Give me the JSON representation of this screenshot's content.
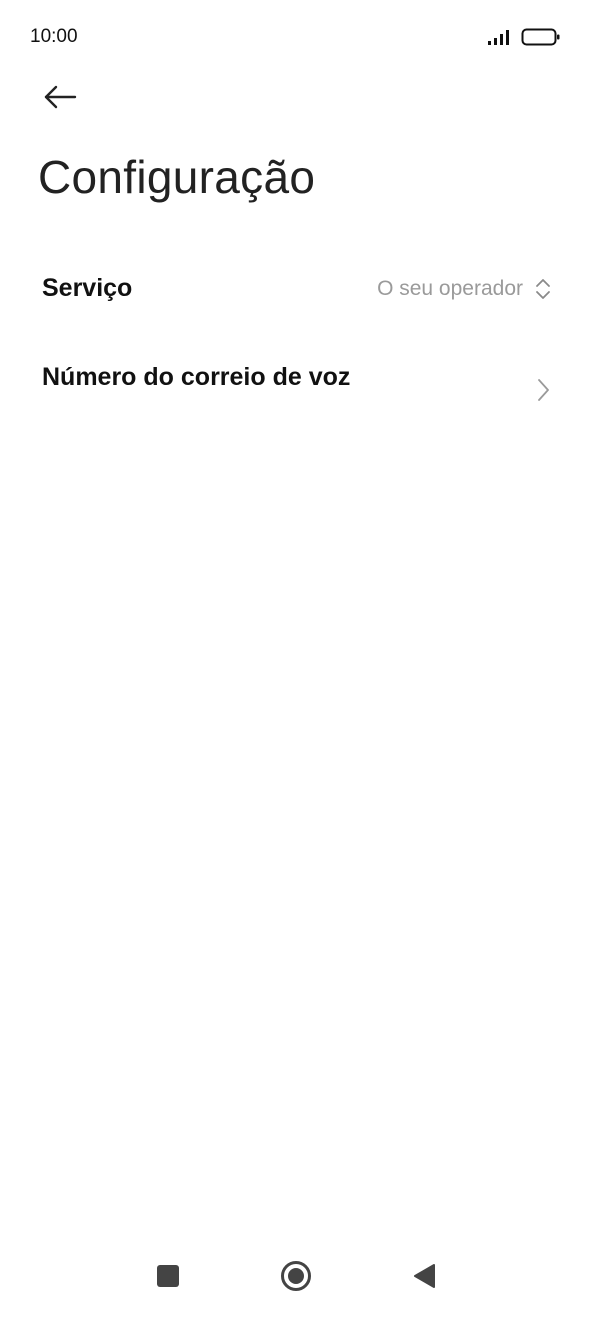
{
  "status_bar": {
    "time": "10:00",
    "signal_icon": "signal-bars-icon",
    "battery_icon": "battery-icon"
  },
  "header": {
    "back_icon": "arrow-left-icon",
    "title": "Configuração"
  },
  "settings": {
    "service": {
      "label": "Serviço",
      "value": "O seu operador",
      "icon": "up-down-chevron-icon"
    },
    "voicemail": {
      "label": "Número do correio de voz",
      "icon": "chevron-right-icon"
    }
  },
  "nav_bar": {
    "recents_icon": "square-icon",
    "home_icon": "circle-icon",
    "back_icon": "triangle-back-icon"
  },
  "colors": {
    "background": "#ffffff",
    "text_primary": "#111111",
    "text_secondary": "#9a9a9a",
    "icon": "#444444"
  }
}
